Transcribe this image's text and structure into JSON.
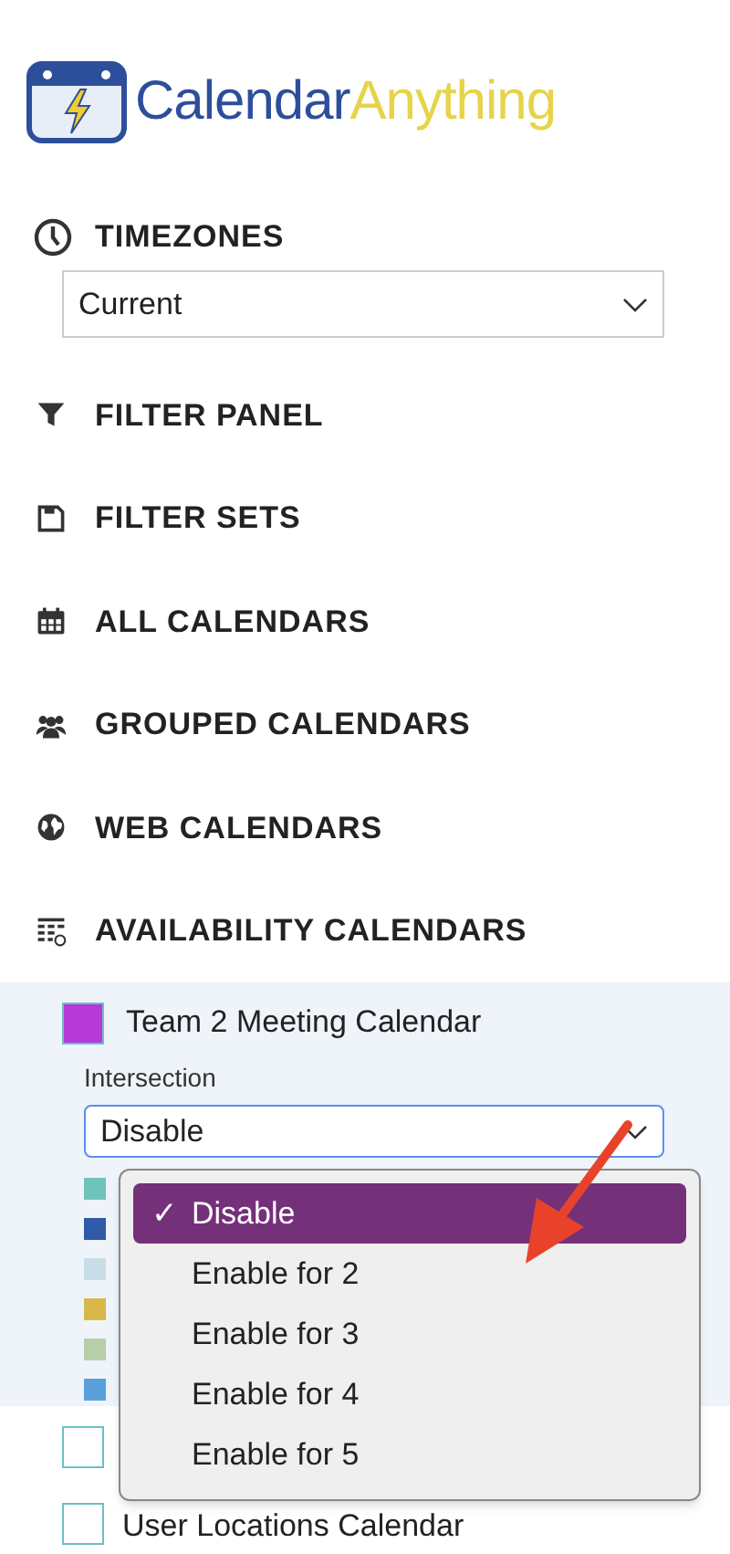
{
  "logo": {
    "word_1": "Calendar",
    "word_2": "Anything"
  },
  "timezones": {
    "heading": "TIMEZONES",
    "value": "Current"
  },
  "nav_items": [
    {
      "kind": "filter",
      "label": "FILTER PANEL"
    },
    {
      "kind": "save",
      "label": "FILTER SETS"
    },
    {
      "kind": "calendar",
      "label": "ALL CALENDARS"
    },
    {
      "kind": "users",
      "label": "GROUPED CALENDARS"
    },
    {
      "kind": "globe",
      "label": "WEB CALENDARS"
    },
    {
      "kind": "grid",
      "label": "AVAILABILITY CALENDARS"
    }
  ],
  "availability": {
    "calendar": {
      "name": "Team 2 Meeting Calendar",
      "checked": true,
      "color": "#b53ad8"
    },
    "intersection_label": "Intersection",
    "intersection_value": "Disable",
    "members": [
      {
        "color": "#6fc3b8"
      },
      {
        "color": "#2e5aa8"
      },
      {
        "color": "#c9dde6"
      },
      {
        "color": "#d8b84a"
      },
      {
        "color": "#b6cfa8"
      },
      {
        "color": "#5aa0d8"
      }
    ]
  },
  "other_calendars": [
    {
      "checked": false
    },
    {
      "name": "User Locations Calendar",
      "checked": false
    }
  ],
  "dropdown_options": [
    {
      "label": "Disable",
      "selected": true,
      "check": "✓"
    },
    {
      "label": "Enable for 2",
      "selected": false
    },
    {
      "label": "Enable for 3",
      "selected": false
    },
    {
      "label": "Enable for 4",
      "selected": false
    },
    {
      "label": "Enable for 5",
      "selected": false
    }
  ]
}
